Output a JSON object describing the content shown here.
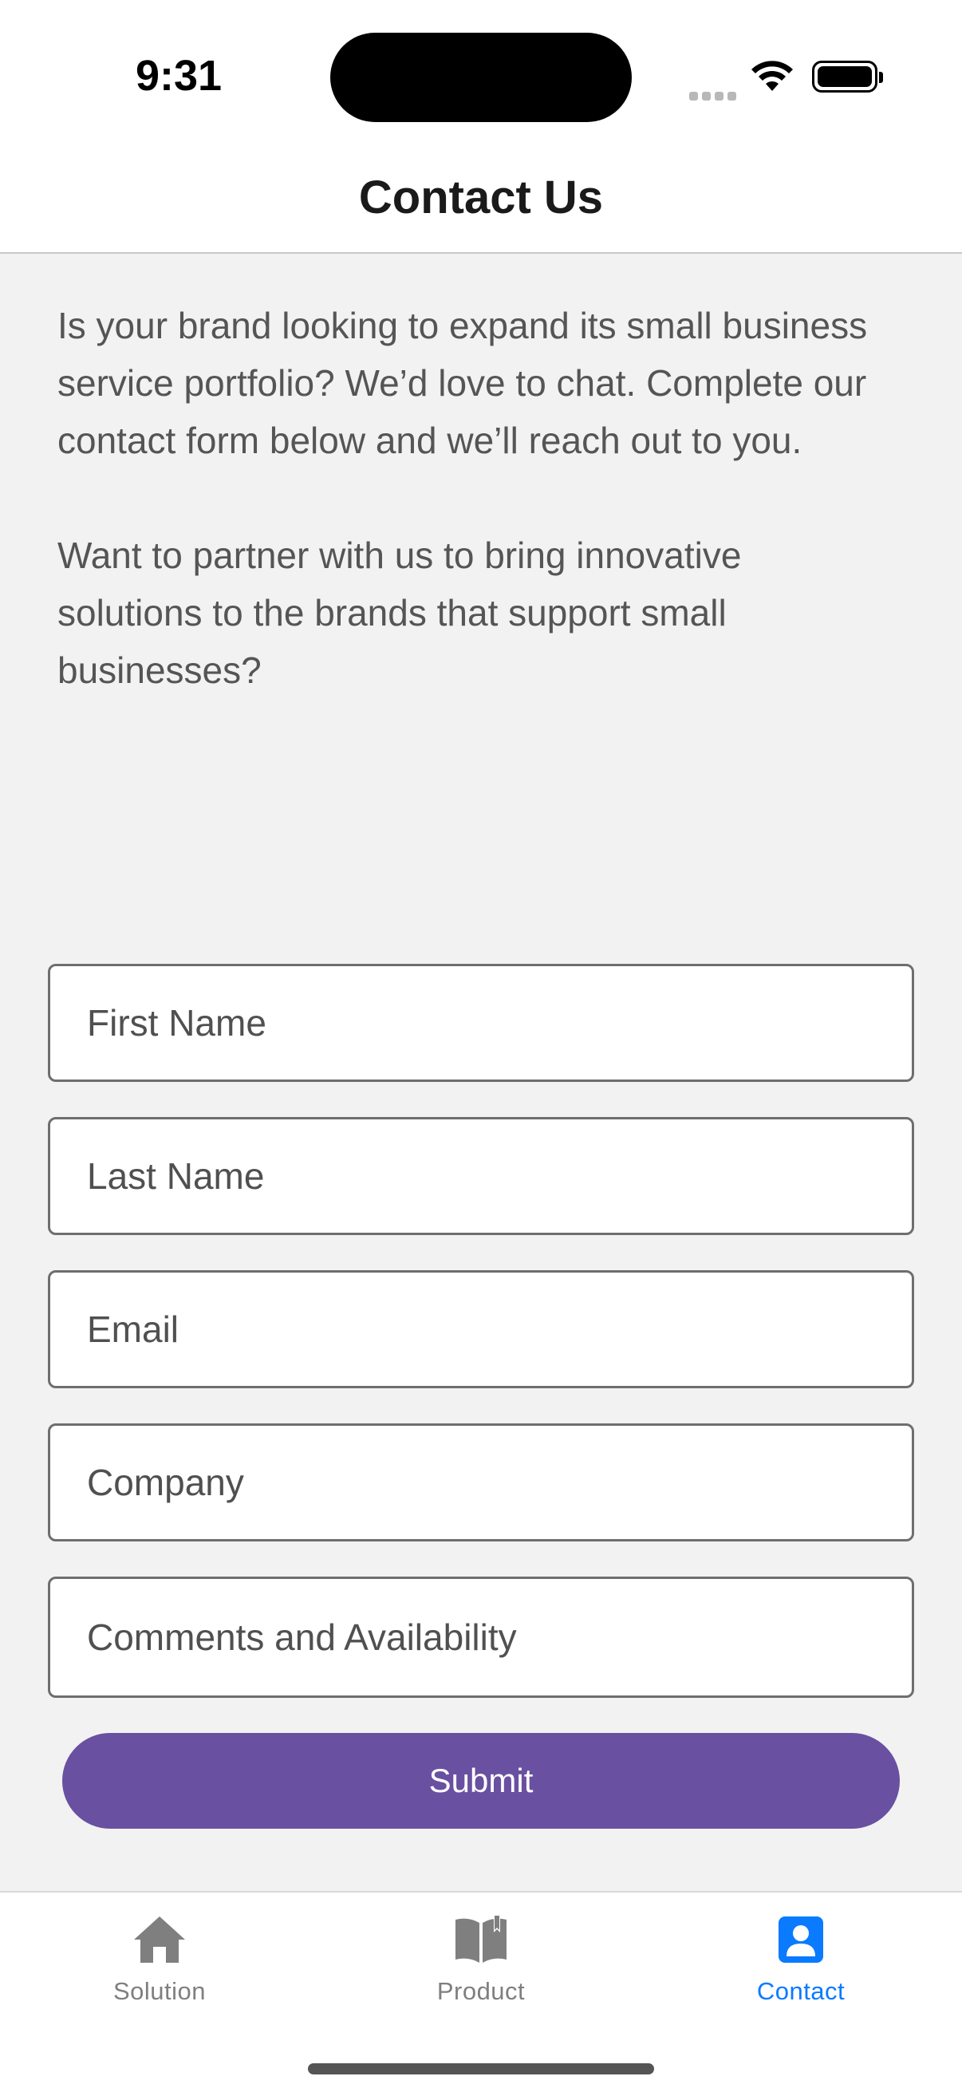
{
  "status_bar": {
    "time": "9:31"
  },
  "nav": {
    "title": "Contact Us"
  },
  "intro": {
    "paragraph1": "Is your brand looking to expand its small business service portfolio? We’d love to chat. Complete our contact form below and we’ll reach out to you.",
    "paragraph2": "Want to partner with us to bring innovative solutions to the brands that support small businesses?"
  },
  "form": {
    "first_name": {
      "placeholder": "First Name",
      "value": ""
    },
    "last_name": {
      "placeholder": "Last Name",
      "value": ""
    },
    "email": {
      "placeholder": "Email",
      "value": ""
    },
    "company": {
      "placeholder": "Company",
      "value": ""
    },
    "comments": {
      "placeholder": "Comments and Availability",
      "value": ""
    },
    "submit_label": "Submit"
  },
  "tabbar": {
    "tabs": [
      {
        "label": "Solution",
        "icon": "house-icon",
        "active": false
      },
      {
        "label": "Product",
        "icon": "open-book-icon",
        "active": false
      },
      {
        "label": "Contact",
        "icon": "person-card-icon",
        "active": true
      }
    ]
  },
  "colors": {
    "accent": "#0a7aff",
    "submit": "#6950a1",
    "background": "#f2f2f2",
    "tab_inactive": "#7f7f7f"
  }
}
